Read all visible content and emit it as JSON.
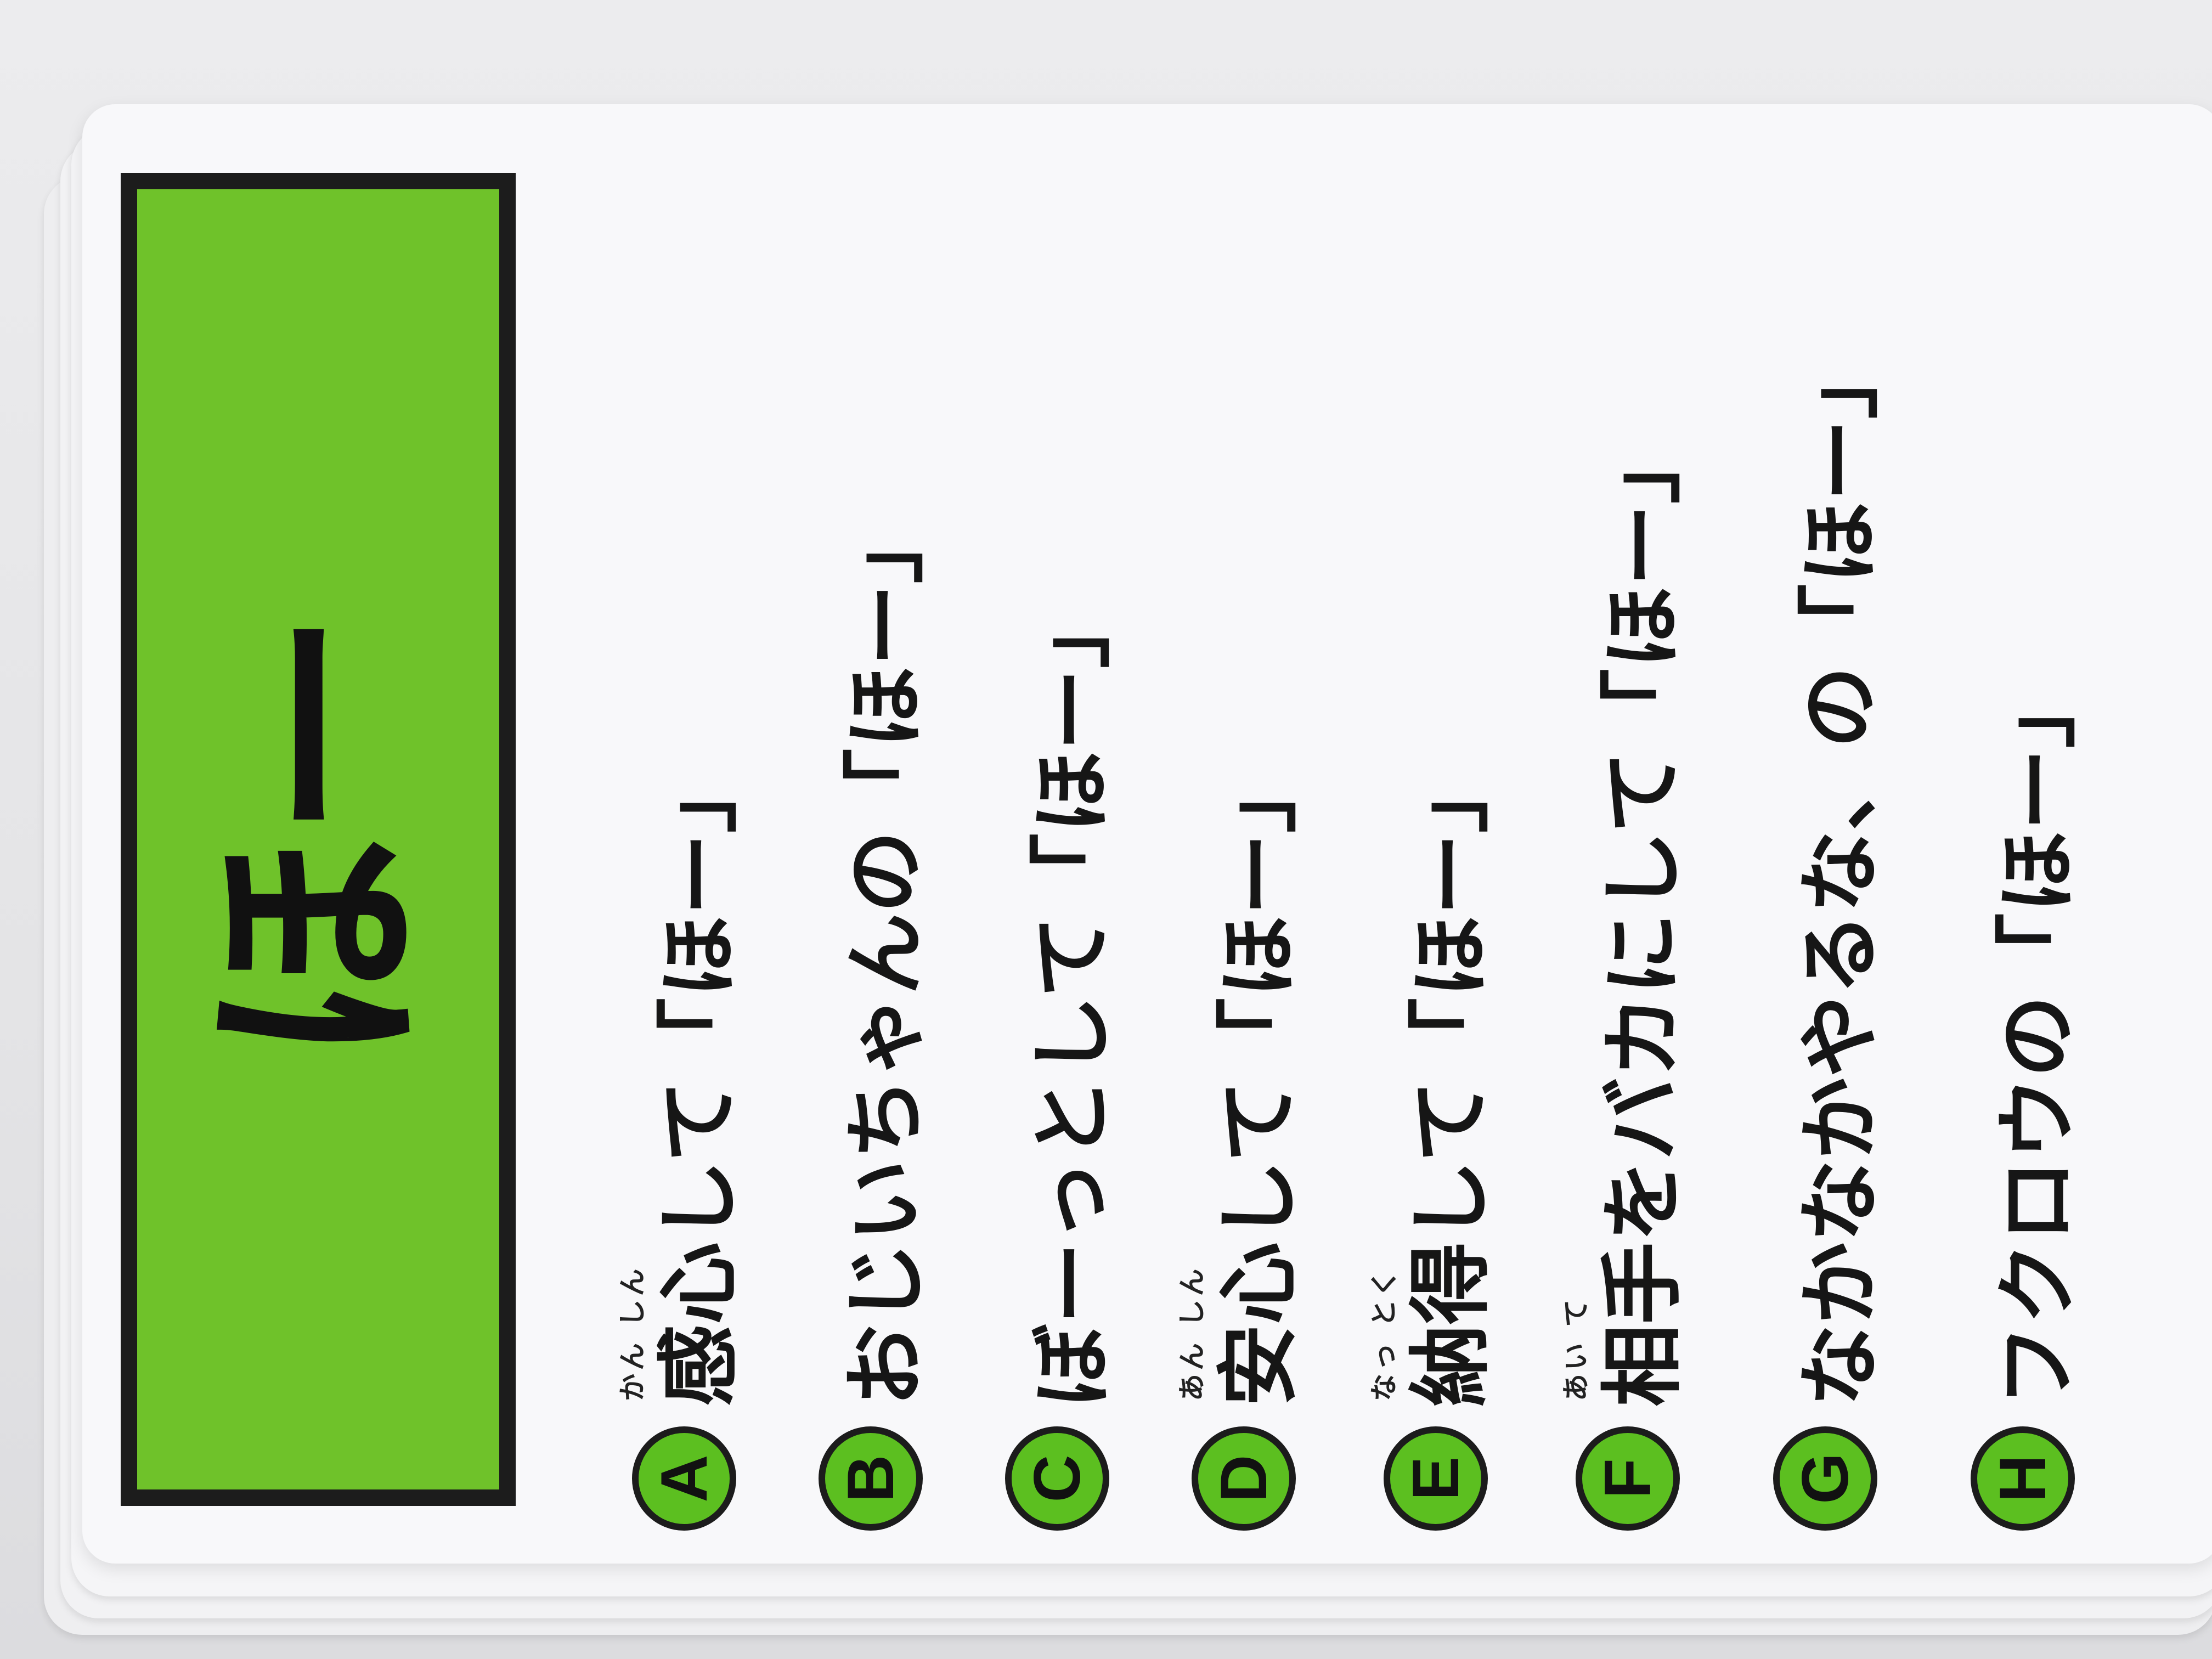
{
  "card": {
    "title": "ほー",
    "title_color": "#6fc22a",
    "badge_color": "#5cbf20",
    "options": [
      {
        "letter": "A",
        "text": "感心して「ほー」",
        "ruby": "かん しん"
      },
      {
        "letter": "B",
        "text": "おじいちゃんの「ほー」",
        "ruby": ""
      },
      {
        "letter": "C",
        "text": "ぼーっとして「ほー」",
        "ruby": ""
      },
      {
        "letter": "D",
        "text": "安心して「ほー」",
        "ruby": "あん しん"
      },
      {
        "letter": "E",
        "text": "納得して「ほー」",
        "ruby": "なっ とく"
      },
      {
        "letter": "F",
        "text": "相手をバカにして「ほー」",
        "ruby": "あい て"
      },
      {
        "letter": "G",
        "text": "なかなかやるな、の「ほー」",
        "ruby": ""
      },
      {
        "letter": "H",
        "text": "フクロウの「ほー」",
        "ruby": ""
      }
    ]
  }
}
